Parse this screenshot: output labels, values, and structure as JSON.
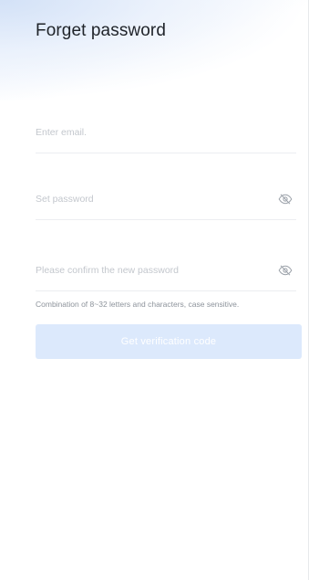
{
  "page": {
    "title": "Forget password"
  },
  "form": {
    "email": {
      "placeholder": "Enter email.",
      "value": ""
    },
    "password": {
      "placeholder": "Set password",
      "value": "",
      "visibility_icon": "eye-off-icon"
    },
    "confirm_password": {
      "placeholder": "Please confirm the new password",
      "value": "",
      "visibility_icon": "eye-off-icon"
    },
    "hint": "Combination of 8~32 letters and characters, case sensitive.",
    "submit_label": "Get verification code"
  },
  "colors": {
    "title_text": "#1f2329",
    "placeholder_text": "#c3c7cd",
    "hint_text": "#8d939b",
    "button_disabled_bg": "#dce9fc",
    "button_text": "#ffffff",
    "divider": "#eceef1"
  }
}
